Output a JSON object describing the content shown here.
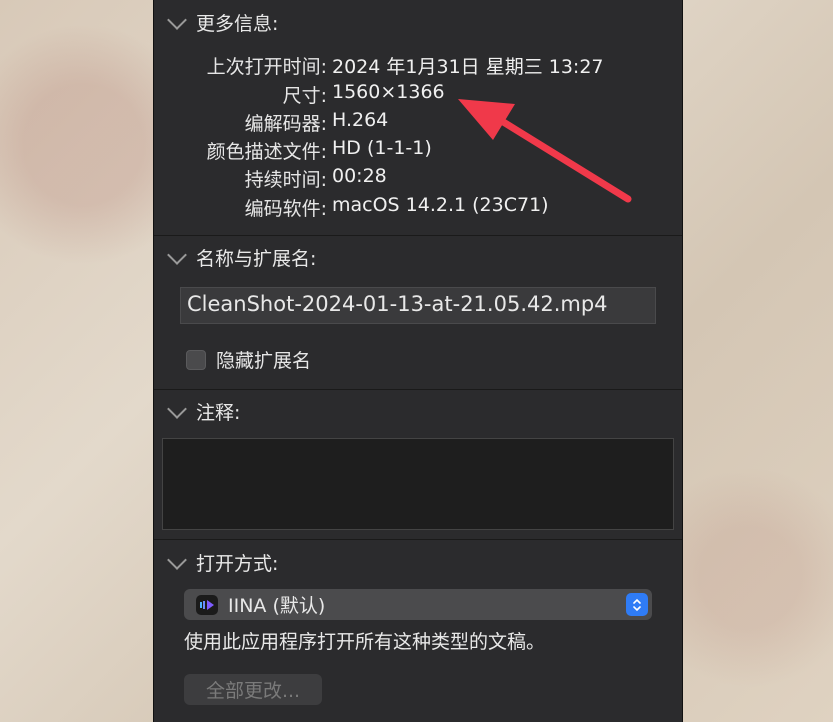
{
  "more_info": {
    "title": "更多信息:",
    "rows": [
      {
        "label": "上次打开时间:",
        "value": "2024 年1月31日 星期三 13:27"
      },
      {
        "label": "尺寸:",
        "value": "1560×1366"
      },
      {
        "label": "编解码器:",
        "value": "H.264"
      },
      {
        "label": "颜色描述文件:",
        "value": "HD (1-1-1)"
      },
      {
        "label": "持续时间:",
        "value": "00:28"
      },
      {
        "label": "编码软件:",
        "value": "macOS 14.2.1 (23C71)"
      }
    ]
  },
  "name_ext": {
    "title": "名称与扩展名:",
    "filename": "CleanShot-2024-01-13-at-21.05.42.mp4",
    "hide_ext_label": "隐藏扩展名"
  },
  "comments": {
    "title": "注释:"
  },
  "open_with": {
    "title": "打开方式:",
    "app_label": "IINA (默认)",
    "description": "使用此应用程序打开所有这种类型的文稿。",
    "change_all_label": "全部更改..."
  },
  "colors": {
    "panel": "#2b2b2d",
    "accent": "#2f7cf6",
    "arrow": "#f0394a"
  }
}
